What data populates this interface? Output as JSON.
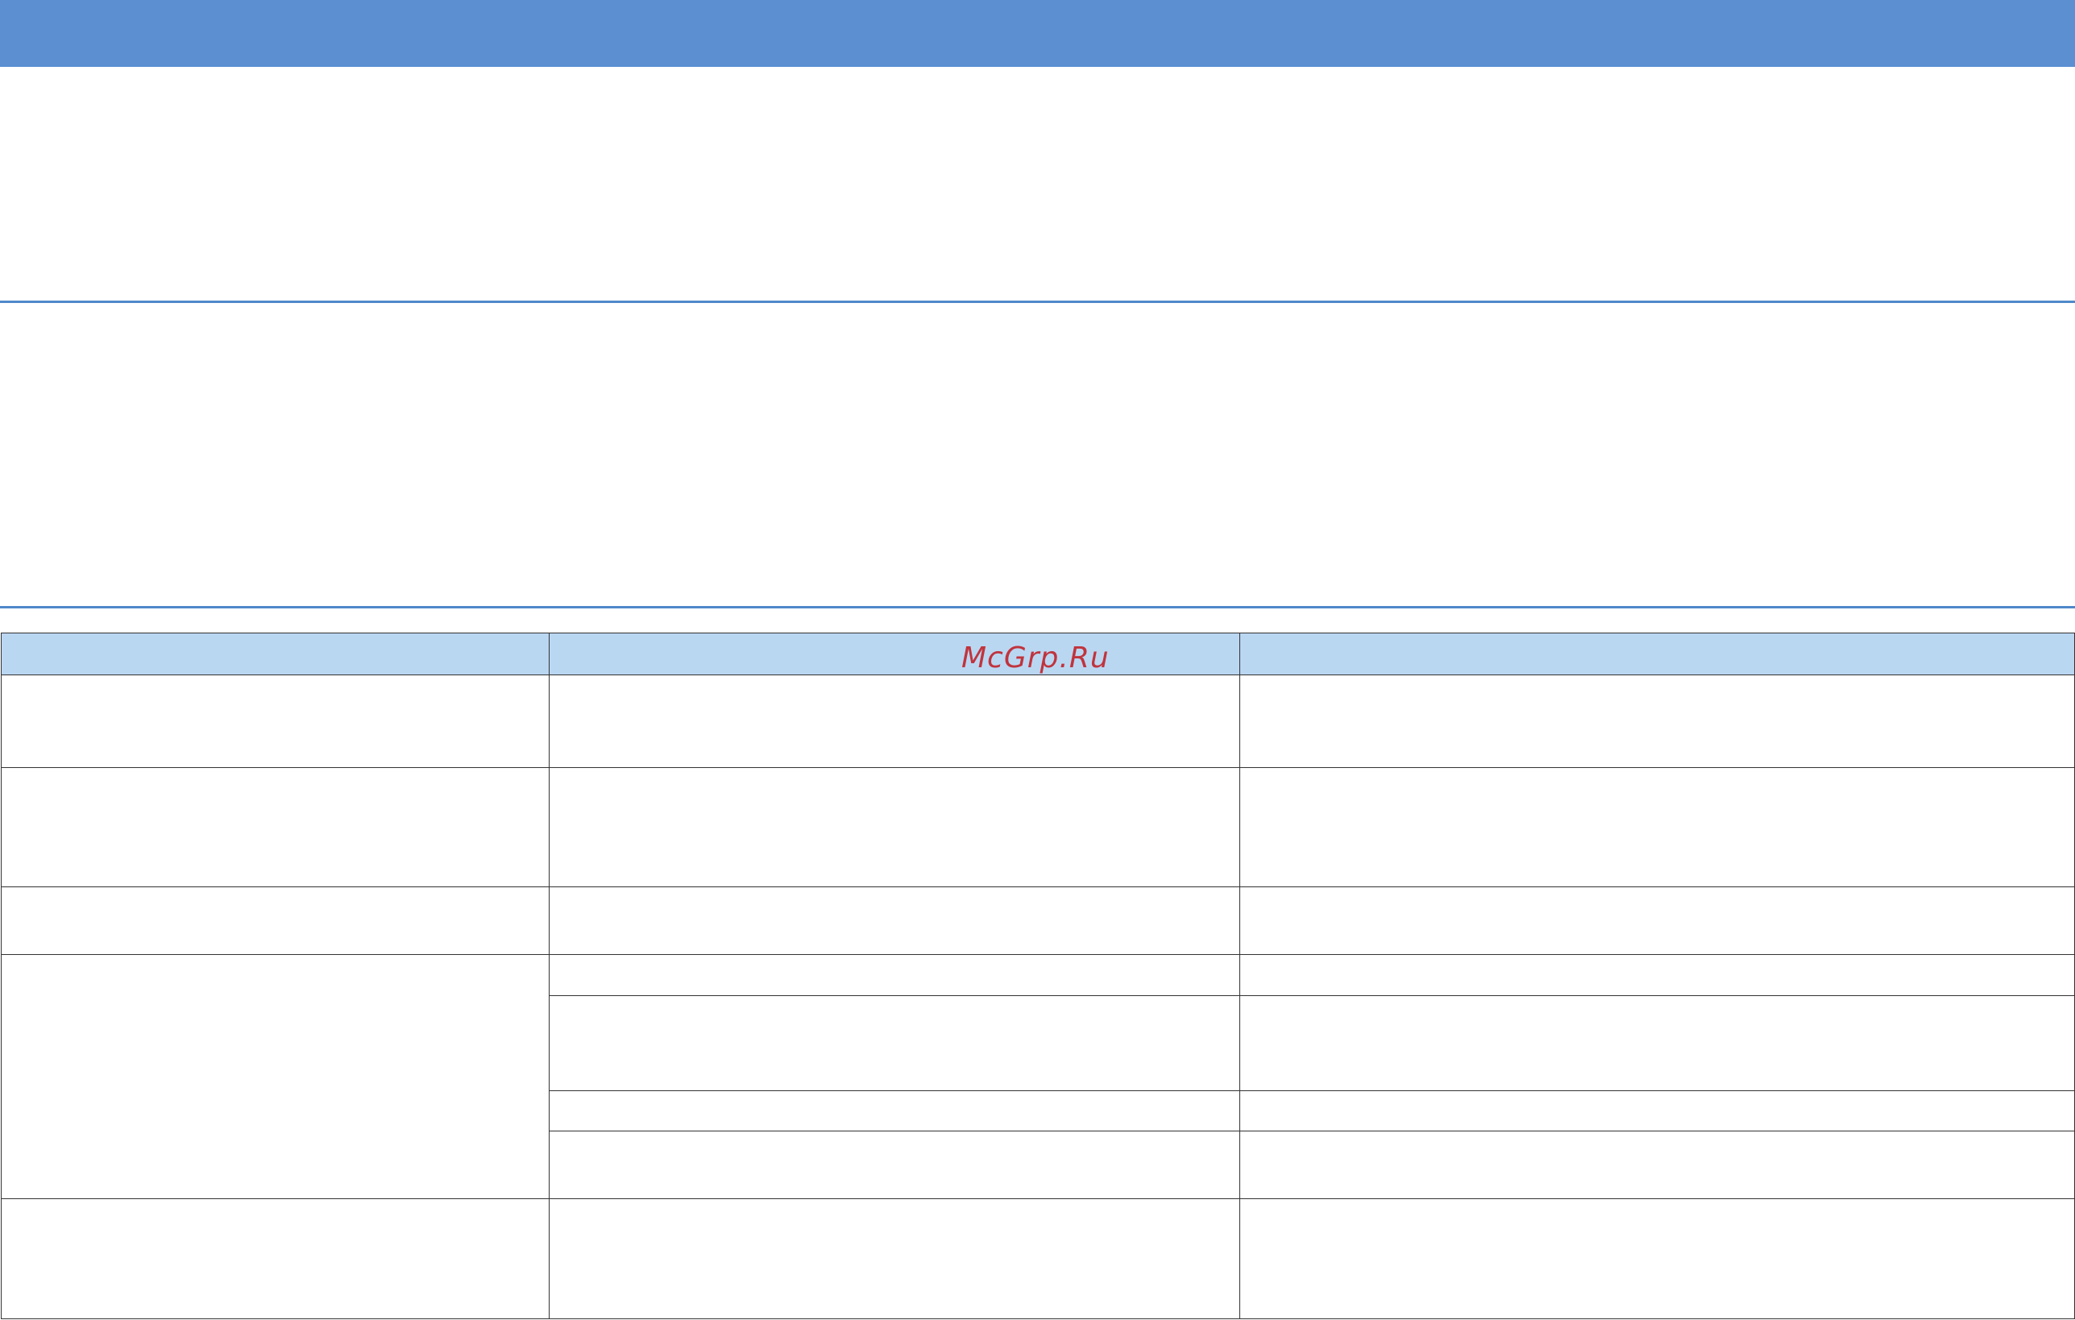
{
  "colors": {
    "header_band": "#5b8fd2",
    "rule": "#4f88c9",
    "table_header_fill": "#bad7f2",
    "grid_line": "#333333",
    "watermark": "#c0343d"
  },
  "watermark": {
    "text": "McGrp.Ru"
  },
  "table": {
    "header": [
      "",
      "",
      ""
    ],
    "rows": [
      [
        "",
        "",
        ""
      ],
      [
        "",
        "",
        ""
      ],
      [
        "",
        "",
        ""
      ],
      [
        "",
        "",
        ""
      ],
      [
        "",
        ""
      ],
      [
        "",
        ""
      ],
      [
        "",
        ""
      ],
      [
        "",
        "",
        ""
      ]
    ]
  }
}
